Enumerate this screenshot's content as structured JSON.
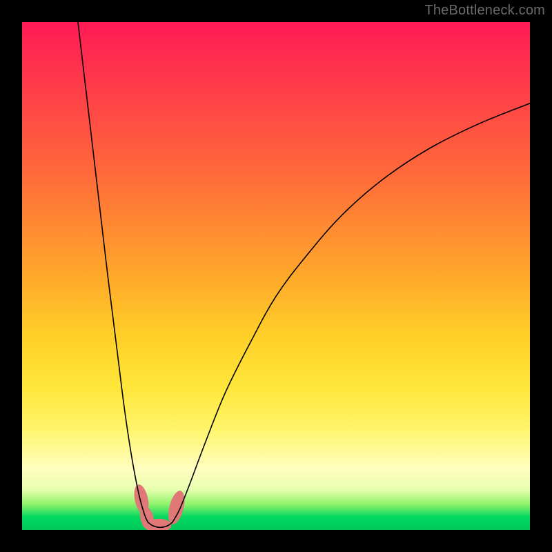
{
  "watermark": "TheBottleneck.com",
  "chart_data": {
    "type": "line",
    "title": "",
    "xlabel": "",
    "ylabel": "",
    "xlim": [
      0,
      100
    ],
    "ylim": [
      0,
      100
    ],
    "series": [
      {
        "name": "left-branch",
        "x": [
          11,
          13,
          15,
          17,
          19,
          20,
          21,
          22,
          23,
          23.8,
          24.3,
          24.8
        ],
        "y": [
          100,
          83,
          66,
          49,
          33,
          25,
          18,
          12,
          7,
          4,
          2.5,
          1.5
        ]
      },
      {
        "name": "valley",
        "x": [
          24.8,
          25.6,
          26.4,
          27.2,
          28.0,
          28.8,
          29.6
        ],
        "y": [
          1.5,
          0.9,
          0.6,
          0.5,
          0.6,
          0.9,
          1.5
        ]
      },
      {
        "name": "right-branch",
        "x": [
          29.6,
          31,
          33,
          36,
          40,
          45,
          50,
          56,
          63,
          71,
          80,
          90,
          100
        ],
        "y": [
          1.5,
          4,
          9,
          17,
          27,
          37,
          46,
          54,
          62,
          69,
          75,
          80,
          84
        ]
      }
    ],
    "markers": [
      {
        "name": "blob-left-upper",
        "x": 23.5,
        "y": 6,
        "rx": 1.3,
        "ry": 3.0,
        "rot": -12
      },
      {
        "name": "blob-left-lower",
        "x": 24.6,
        "y": 2.3,
        "rx": 1.3,
        "ry": 2.4,
        "rot": -14
      },
      {
        "name": "blob-bottom",
        "x": 27.0,
        "y": 0.9,
        "rx": 2.4,
        "ry": 1.3,
        "rot": 0
      },
      {
        "name": "blob-right",
        "x": 30.4,
        "y": 4.4,
        "rx": 1.4,
        "ry": 3.4,
        "rot": 14
      }
    ],
    "background_gradient": {
      "direction": "top-to-bottom",
      "stops": [
        {
          "pos": 0.0,
          "color": "#ff1a55"
        },
        {
          "pos": 0.5,
          "color": "#ffa82a"
        },
        {
          "pos": 0.8,
          "color": "#fff56a"
        },
        {
          "pos": 0.95,
          "color": "#8cf26a"
        },
        {
          "pos": 1.0,
          "color": "#00c858"
        }
      ]
    }
  }
}
